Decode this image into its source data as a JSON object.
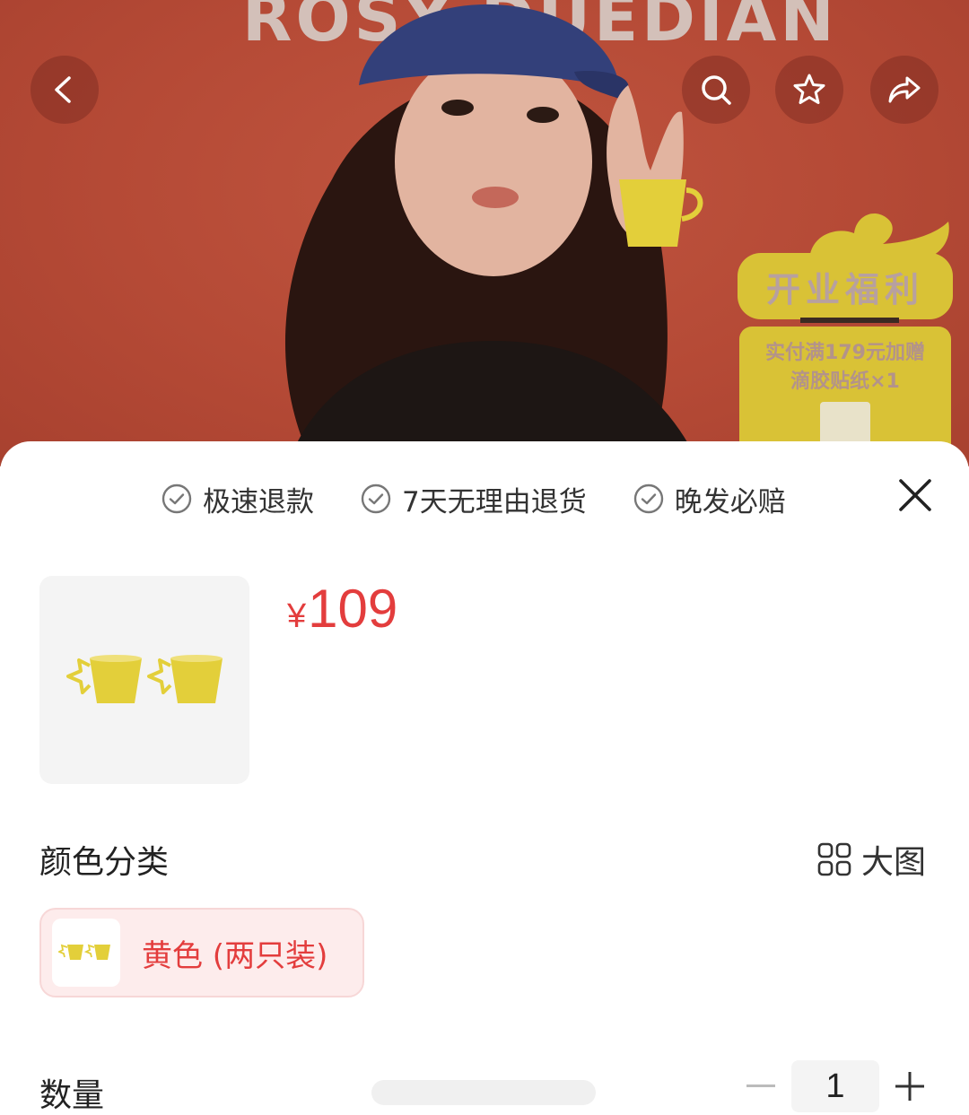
{
  "hero": {
    "brand_text": "ROSY DUEDIAN",
    "promo": {
      "title": "开业福利",
      "line1": "实付满179元加赠",
      "line2": "滴胶贴纸×1"
    },
    "icons": [
      "back-icon",
      "search-icon",
      "star-icon",
      "share-icon"
    ]
  },
  "sheet": {
    "guarantees": [
      {
        "icon": "check-circle-icon",
        "label": "极速退款"
      },
      {
        "icon": "check-circle-icon",
        "label": "7天无理由退货"
      },
      {
        "icon": "check-circle-icon",
        "label": "晚发必赔"
      }
    ],
    "price": {
      "currency": "¥",
      "amount": "109"
    },
    "color_section": {
      "title": "颜色分类",
      "big_view_label": "大图",
      "options": [
        {
          "label": "黄色 (两只装)",
          "selected": true
        }
      ]
    },
    "quantity": {
      "label": "数量",
      "value": "1"
    }
  },
  "colors": {
    "accent": "#e33d3d",
    "selected_bg": "#fdecec",
    "hero_bg": "#b54a36",
    "promo_yellow": "#d9c236",
    "product_yellow": "#e3cf3a"
  }
}
